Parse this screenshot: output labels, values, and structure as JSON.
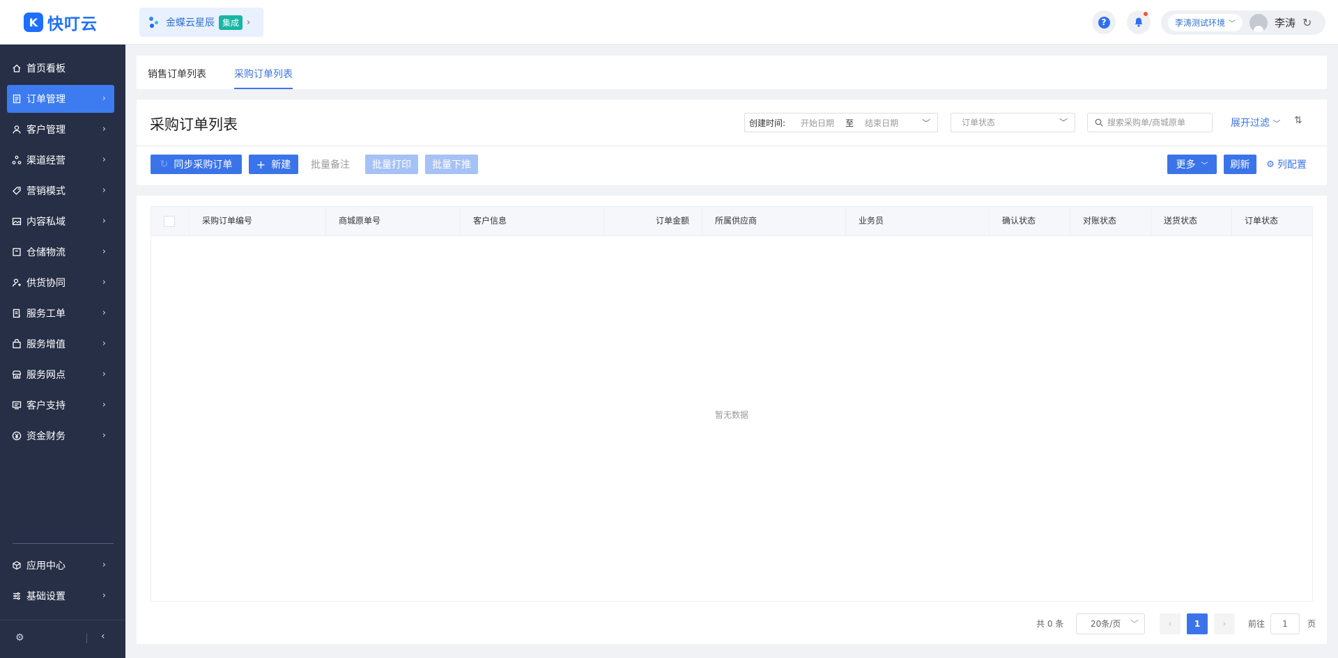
{
  "app": {
    "logo_text": "快叮云"
  },
  "integration": {
    "name": "金蝶云星辰",
    "badge": "集成"
  },
  "header": {
    "env": "李涛测试环境",
    "user": "李涛"
  },
  "sidebar": {
    "items": [
      {
        "label": "首页看板",
        "icon": "home-icon"
      },
      {
        "label": "订单管理",
        "icon": "order-icon"
      },
      {
        "label": "客户管理",
        "icon": "user-icon"
      },
      {
        "label": "渠道经营",
        "icon": "channel-icon"
      },
      {
        "label": "营销模式",
        "icon": "tag-icon"
      },
      {
        "label": "内容私域",
        "icon": "image-icon"
      },
      {
        "label": "仓储物流",
        "icon": "box-icon"
      },
      {
        "label": "供货协同",
        "icon": "supply-icon"
      },
      {
        "label": "服务工单",
        "icon": "ticket-icon"
      },
      {
        "label": "服务增值",
        "icon": "bag-icon"
      },
      {
        "label": "服务网点",
        "icon": "store-icon"
      },
      {
        "label": "客户支持",
        "icon": "support-icon"
      },
      {
        "label": "资金财务",
        "icon": "yen-icon"
      }
    ],
    "bottom_items": [
      {
        "label": "应用中心",
        "icon": "cube-icon"
      },
      {
        "label": "基础设置",
        "icon": "settings-icon"
      }
    ]
  },
  "tabs": [
    {
      "label": "销售订单列表"
    },
    {
      "label": "采购订单列表"
    }
  ],
  "list": {
    "title": "采购订单列表",
    "filter": {
      "date_label": "创建时间:",
      "start_placeholder": "开始日期",
      "to": "至",
      "end_placeholder": "结束日期",
      "status_placeholder": "订单状态",
      "search_placeholder": "搜索采购单/商城原单",
      "expand": "展开过滤"
    },
    "buttons": {
      "sync": "同步采购订单",
      "new": "新建",
      "batch_note": "批量备注",
      "batch_print": "批量打印",
      "batch_push": "批量下推",
      "more": "更多",
      "refresh": "刷新",
      "column_config": "列配置"
    }
  },
  "table": {
    "columns": [
      "采购订单编号",
      "商城原单号",
      "客户信息",
      "订单金额",
      "所属供应商",
      "业务员",
      "确认状态",
      "对账状态",
      "送货状态",
      "订单状态"
    ],
    "empty_text": "暂无数据"
  },
  "pagination": {
    "total": "共 0 条",
    "page_size": "20条/页",
    "current_page": "1",
    "goto_label": "前往",
    "goto_value": "1",
    "page_suffix": "页"
  },
  "colors": {
    "accent": "#3b74e9",
    "sidebar_bg": "#262f45",
    "disabled": "#a6c2f5"
  }
}
